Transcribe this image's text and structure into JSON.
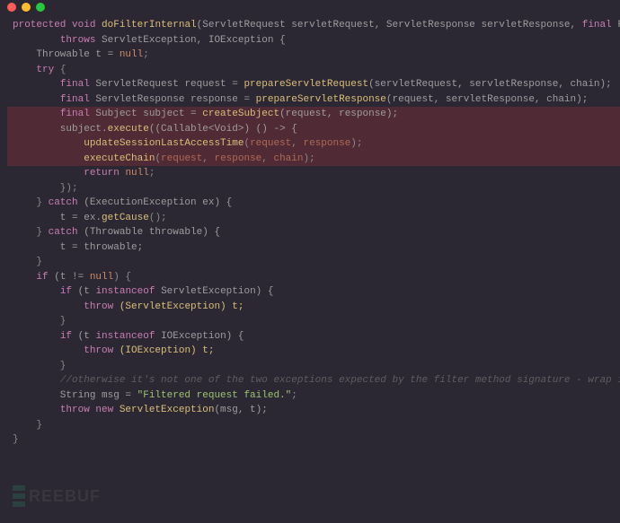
{
  "titlebar": {
    "buttons": [
      "close",
      "minimize",
      "zoom"
    ]
  },
  "watermark": "REEBUF",
  "code": {
    "l1": {
      "p0": "protected ",
      "p1": "void ",
      "p2": "doFilterInternal",
      "p3": "(ServletRequest servletRequest, ServletResponse servletResponse, ",
      "p4": "final ",
      "p5": "FilterChain chain)"
    },
    "l2": {
      "p0": "        ",
      "p1": "throws ",
      "p2": "ServletException, IOException {"
    },
    "l3": "",
    "l4": {
      "p0": "    Throwable t = ",
      "p1": "null",
      "p2": ";"
    },
    "l5": "",
    "l6": {
      "p0": "    ",
      "p1": "try ",
      "p2": "{"
    },
    "l7": {
      "p0": "        ",
      "p1": "final ",
      "p2": "ServletRequest request = ",
      "p3": "prepareServletRequest",
      "p4": "(servletRequest, servletResponse, chain);"
    },
    "l8": {
      "p0": "        ",
      "p1": "final ",
      "p2": "ServletResponse response = ",
      "p3": "prepareServletResponse",
      "p4": "(request, servletResponse, chain);"
    },
    "l9": "",
    "l10": {
      "p0": "        ",
      "p1": "final ",
      "p2": "Subject subject = ",
      "p3": "createSubject",
      "p4": "(request, response);"
    },
    "l11": "",
    "l12": {
      "p0": "        subject.",
      "p1": "execute",
      "p2": "((Callable<Void>) () -> {"
    },
    "l13": {
      "p0": "            ",
      "p1": "updateSessionLastAccessTime",
      "p2": "(",
      "p3": "request",
      "p4": ", ",
      "p5": "response",
      "p6": ");"
    },
    "l14": {
      "p0": "            ",
      "p1": "executeChain",
      "p2": "(",
      "p3": "request",
      "p4": ", ",
      "p5": "response",
      "p6": ", ",
      "p7": "chain",
      "p8": ");"
    },
    "l15": {
      "p0": "            ",
      "p1": "return ",
      "p2": "null",
      "p3": ";"
    },
    "l16": {
      "p0": "        });"
    },
    "l17": {
      "p0": "    } ",
      "p1": "catch ",
      "p2": "(ExecutionException ex) {"
    },
    "l18": {
      "p0": "        t = ex.",
      "p1": "getCause",
      "p2": "();"
    },
    "l19": {
      "p0": "    } ",
      "p1": "catch ",
      "p2": "(Throwable throwable) {"
    },
    "l20": {
      "p0": "        t = throwable;"
    },
    "l21": {
      "p0": "    }"
    },
    "l22": "",
    "l23": {
      "p0": "    ",
      "p1": "if ",
      "p2": "(t != ",
      "p3": "null",
      "p4": ") {"
    },
    "l24": {
      "p0": "        ",
      "p1": "if ",
      "p2": "(t ",
      "p3": "instanceof ",
      "p4": "ServletException) {"
    },
    "l25": {
      "p0": "            ",
      "p1": "throw ",
      "p2": "(ServletException) t;"
    },
    "l26": {
      "p0": "        }"
    },
    "l27": {
      "p0": "        ",
      "p1": "if ",
      "p2": "(t ",
      "p3": "instanceof ",
      "p4": "IOException) {"
    },
    "l28": {
      "p0": "            ",
      "p1": "throw ",
      "p2": "(IOException) t;"
    },
    "l29": {
      "p0": "        }"
    },
    "l30": {
      "p0": "        ",
      "p1": "//otherwise it's not one of the two exceptions expected by the filter method signature - wrap it in one:"
    },
    "l31": {
      "p0": "        String msg = ",
      "p1": "\"Filtered request failed.\"",
      "p2": ";"
    },
    "l32": {
      "p0": "        ",
      "p1": "throw new ",
      "p2": "ServletException",
      "p3": "(msg, t);"
    },
    "l33": {
      "p0": "    }"
    },
    "l34": {
      "p0": "}"
    }
  }
}
